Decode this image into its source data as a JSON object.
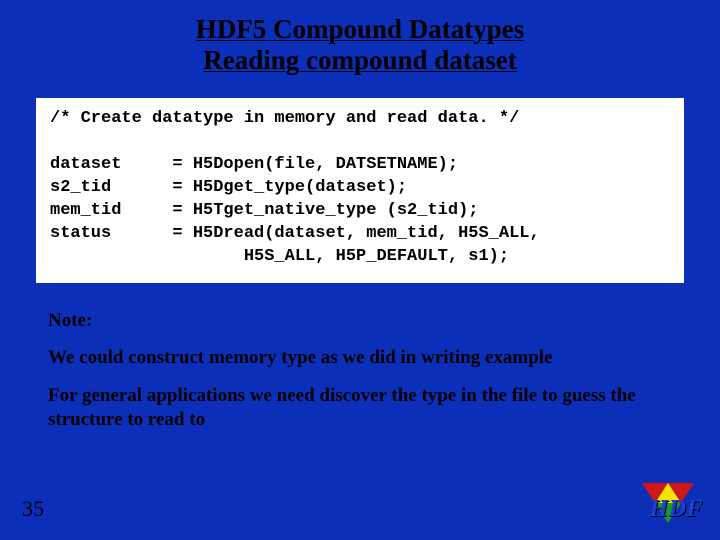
{
  "title": {
    "line1": "HDF5 Compound Datatypes",
    "line2": "Reading compound dataset"
  },
  "code": {
    "comment": "/* Create datatype in memory and read data. */",
    "l1": "dataset     = H5Dopen(file, DATSETNAME);",
    "l2": "s2_tid      = H5Dget_type(dataset);",
    "l3": "mem_tid     = H5Tget_native_type (s2_tid);",
    "l4": "status      = H5Dread(dataset, mem_tid, H5S_ALL,",
    "l5": "                   H5S_ALL, H5P_DEFAULT, s1);"
  },
  "notes": {
    "label": "Note:",
    "p1": "We could construct memory type as we did in writing example",
    "p2": "For general applications we need discover the type in the file to guess the structure to read to"
  },
  "slidenum": "35",
  "logo_text": "HDF"
}
